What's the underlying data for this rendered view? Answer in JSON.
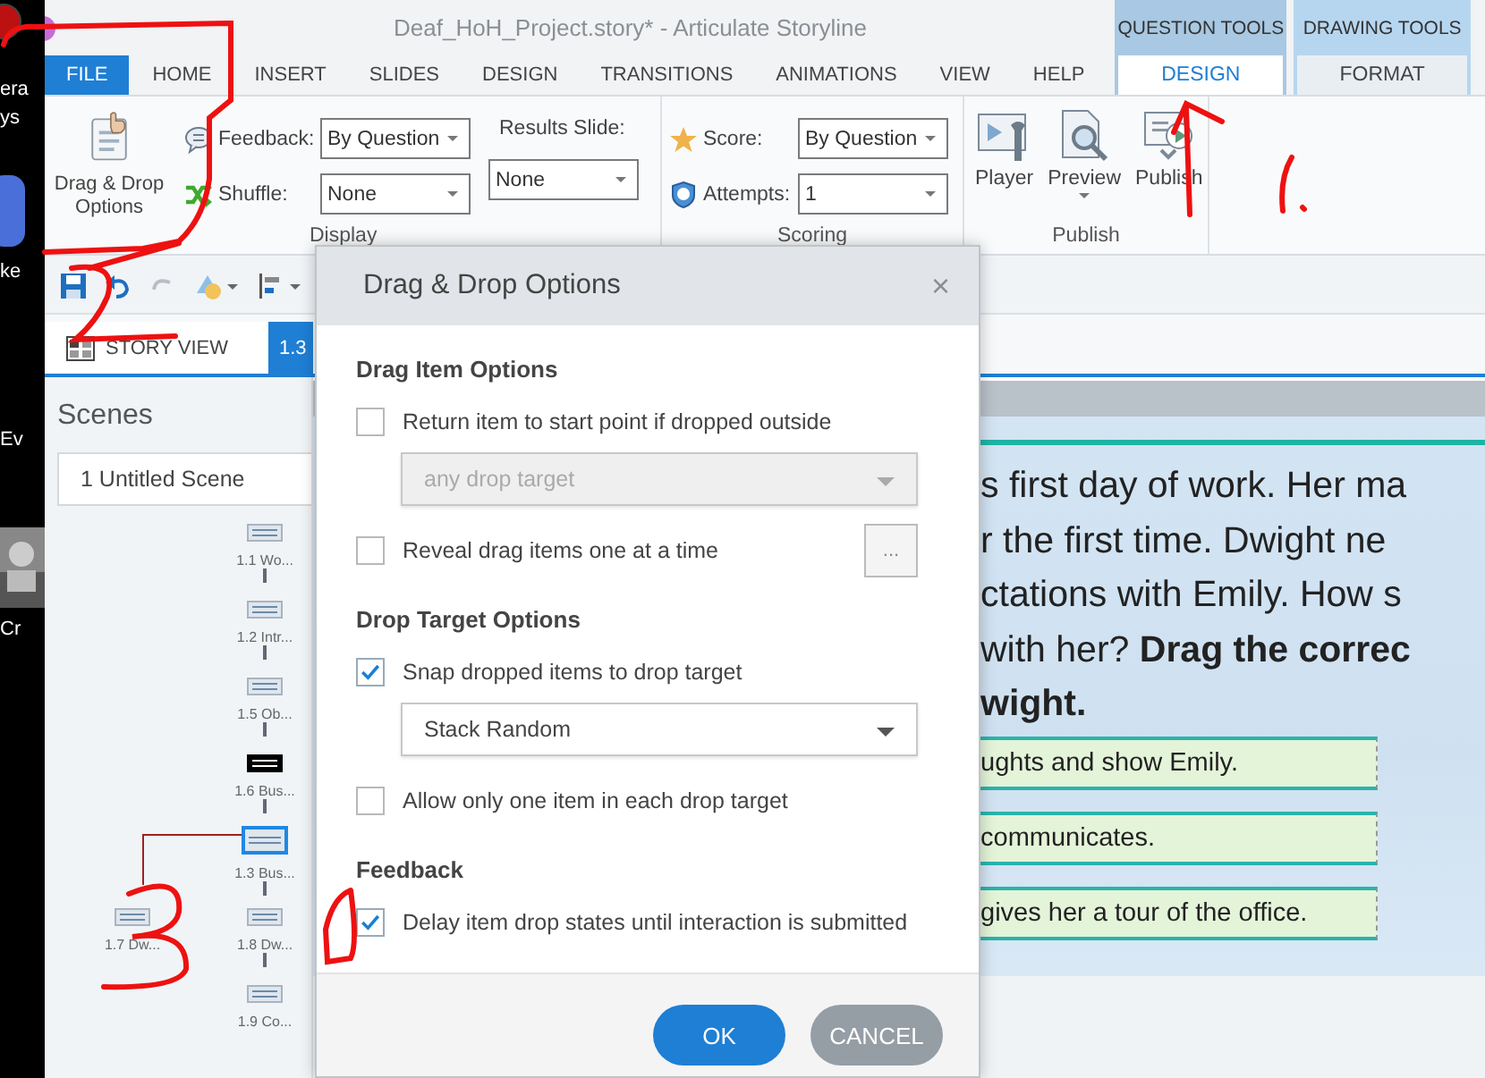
{
  "desktop": {
    "fragments": [
      "era",
      "ys",
      "ke",
      "Ev",
      "Cr"
    ]
  },
  "window": {
    "title": "Deaf_HoH_Project.story*  -  Articulate Storyline"
  },
  "tabs": [
    {
      "label": "FILE",
      "kind": "file",
      "selected": false
    },
    {
      "label": "HOME",
      "kind": "normal",
      "selected": false
    },
    {
      "label": "INSERT",
      "kind": "normal",
      "selected": false
    },
    {
      "label": "SLIDES",
      "kind": "normal",
      "selected": false
    },
    {
      "label": "DESIGN",
      "kind": "normal",
      "selected": false
    },
    {
      "label": "TRANSITIONS",
      "kind": "normal",
      "selected": false
    },
    {
      "label": "ANIMATIONS",
      "kind": "normal",
      "selected": false
    },
    {
      "label": "VIEW",
      "kind": "normal",
      "selected": false
    },
    {
      "label": "HELP",
      "kind": "normal",
      "selected": false
    }
  ],
  "context_groups": [
    {
      "label": "QUESTION TOOLS",
      "tab": {
        "label": "DESIGN",
        "selected": true
      }
    },
    {
      "label": "DRAWING TOOLS",
      "tab": {
        "label": "FORMAT",
        "selected": false
      }
    }
  ],
  "ribbon": {
    "drag_drop_button": "Drag & Drop Options",
    "feedback": {
      "label": "Feedback:",
      "value": "By Question"
    },
    "shuffle": {
      "label": "Shuffle:",
      "value": "None"
    },
    "display_group": "Display",
    "results_slide": {
      "label": "Results Slide:",
      "value": "None"
    },
    "score": {
      "label": "Score:",
      "value": "By Question"
    },
    "attempts": {
      "label": "Attempts:",
      "value": "1"
    },
    "scoring_group": "Scoring",
    "publish_buttons": [
      {
        "label": "Player",
        "kind": "player",
        "dropdown": false
      },
      {
        "label": "Preview",
        "kind": "preview",
        "dropdown": true
      },
      {
        "label": "Publish",
        "kind": "publish",
        "dropdown": false
      }
    ],
    "publish_group": "Publish"
  },
  "view_tabs": [
    {
      "label": "STORY VIEW",
      "selected": false
    },
    {
      "label": "1.3",
      "selected": true
    }
  ],
  "scenes": {
    "title": "Scenes",
    "scene": "1 Untitled Scene",
    "slides": [
      {
        "label": "1.1 Wo...",
        "kind": "main",
        "selected": false,
        "dark": false
      },
      {
        "label": "1.2 Intr...",
        "kind": "main",
        "selected": false,
        "dark": false
      },
      {
        "label": "1.5 Ob...",
        "kind": "main",
        "selected": false,
        "dark": false
      },
      {
        "label": "1.6 Bus...",
        "kind": "main",
        "selected": false,
        "dark": true
      },
      {
        "label": "1.3 Bus...",
        "kind": "main",
        "selected": true,
        "dark": false
      },
      {
        "label": "1.7 Dw...",
        "kind": "branch",
        "selected": false,
        "dark": false
      },
      {
        "label": "1.8 Dw...",
        "kind": "main",
        "selected": false,
        "dark": false
      },
      {
        "label": "1.9 Co...",
        "kind": "main",
        "selected": false,
        "dark": false
      }
    ]
  },
  "slide": {
    "lines": [
      "s first day of work. Her ma",
      "r the first time. Dwight ne",
      "ctations with Emily. How s",
      "with her? **Drag the correc**",
      "**wight.**"
    ],
    "answers": [
      "ughts and show Emily.",
      "communicates.",
      "gives her a tour of the office."
    ]
  },
  "dialog": {
    "title": "Drag & Drop Options",
    "close": "×",
    "sections": [
      {
        "heading": "Drag Item Options",
        "items": [
          {
            "kind": "checkbox",
            "label": "Return item to start point if dropped outside",
            "checked": false
          },
          {
            "kind": "select",
            "value": "any drop target",
            "disabled": true
          },
          {
            "kind": "checkbox",
            "label": "Reveal drag items one at a time",
            "checked": false,
            "more_button": "..."
          }
        ]
      },
      {
        "heading": "Drop Target Options",
        "items": [
          {
            "kind": "checkbox",
            "label": "Snap dropped items to drop target",
            "checked": true
          },
          {
            "kind": "select",
            "value": "Stack Random",
            "disabled": false
          },
          {
            "kind": "checkbox",
            "label": "Allow only one item in each drop target",
            "checked": false
          }
        ]
      },
      {
        "heading": "Feedback",
        "items": [
          {
            "kind": "checkbox",
            "label": "Delay item drop states until interaction is submitted",
            "checked": true
          }
        ]
      }
    ],
    "buttons": [
      {
        "label": "OK",
        "kind": "primary"
      },
      {
        "label": "CANCEL",
        "kind": "secondary"
      }
    ]
  }
}
